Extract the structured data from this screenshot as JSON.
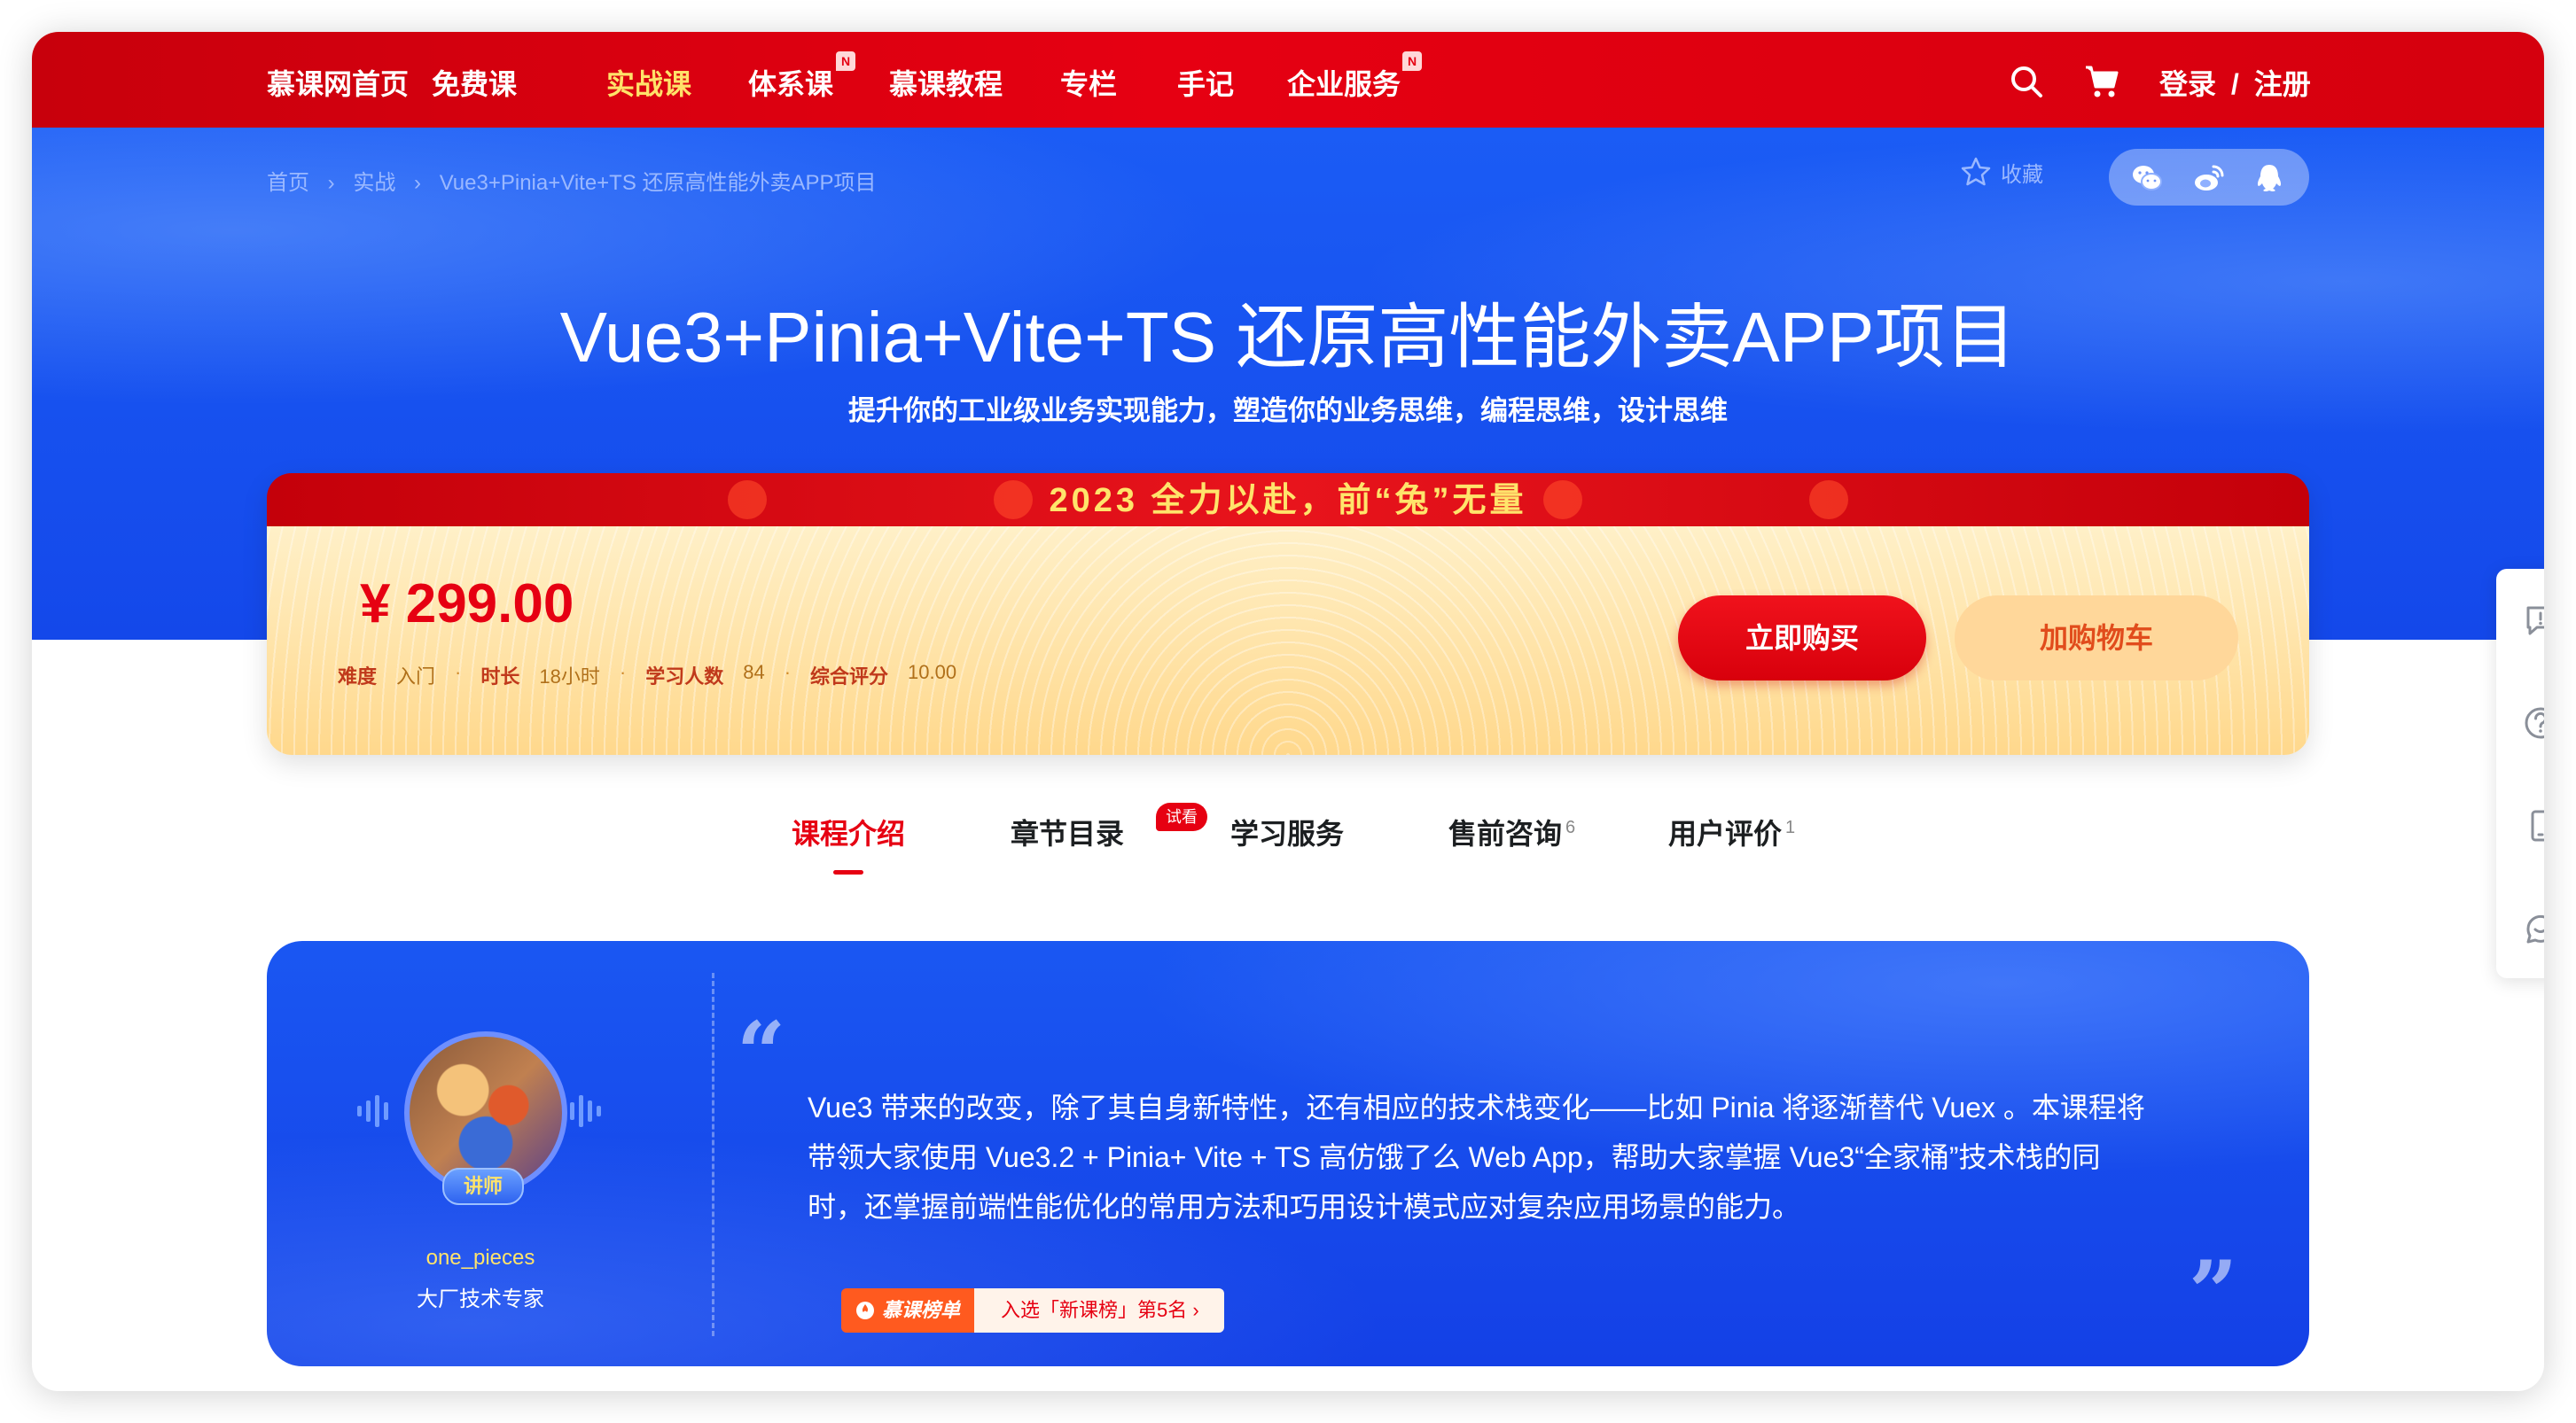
{
  "nav": {
    "items": [
      {
        "label": "慕课网首页"
      },
      {
        "label": "免费课"
      },
      {
        "label": "实战课"
      },
      {
        "label": "体系课",
        "badge": "N"
      },
      {
        "label": "慕课教程"
      },
      {
        "label": "专栏"
      },
      {
        "label": "手记"
      },
      {
        "label": "企业服务",
        "badge": "N"
      }
    ],
    "active": "实战课",
    "login": "登录",
    "separator": "/",
    "register": "注册"
  },
  "breadcrumb": {
    "home": "首页",
    "category": "实战",
    "current": "Vue3+Pinia+Vite+TS 还原高性能外卖APP项目",
    "sep": "›"
  },
  "favorite_label": "收藏",
  "share": [
    "wechat-icon",
    "weibo-icon",
    "qq-icon"
  ],
  "hero": {
    "title": "Vue3+Pinia+Vite+TS 还原高性能外卖APP项目",
    "subtitle": "提升你的工业级业务实现能力，塑造你的业务思维，编程思维，设计思维"
  },
  "promo": {
    "text": "2023 全力以赴，前“兔”无量"
  },
  "price": {
    "amount": "¥ 299.00",
    "difficulty_label": "难度",
    "difficulty": "入门",
    "duration_label": "时长",
    "duration": "18小时",
    "students_label": "学习人数",
    "students": "84",
    "rating_label": "综合评分",
    "rating": "10.00",
    "dot": "·",
    "buy_label": "立即购买",
    "cart_label": "加购物车"
  },
  "tabs": {
    "intro": "课程介绍",
    "chapters": "章节目录",
    "chapters_badge": "试看",
    "service": "学习服务",
    "consult": "售前咨询",
    "consult_count": "6",
    "reviews": "用户评价",
    "reviews_count": "1"
  },
  "teacher": {
    "tag": "讲师",
    "name": "one_pieces",
    "title": "大厂技术专家",
    "intro": "Vue3 带来的改变，除了其自身新特性，还有相应的技术栈变化——比如 Pinia 将逐渐替代 Vuex 。本课程将带领大家使用 Vue3.2 + Pinia+ Vite + TS 高仿饿了么 Web App，帮助大家掌握 Vue3“全家桶”技术栈的同时，还掌握前端性能优化的常用方法和巧用设计模式应对复杂应用场景的能力。",
    "rank_label": "慕课榜单",
    "rank_text": "入选「新课榜」第5名 ›"
  },
  "colors": {
    "nav_red": "#e60012",
    "hero_blue": "#1b5cf5",
    "active_yellow": "#ffe26a",
    "price_red": "#e60012"
  }
}
